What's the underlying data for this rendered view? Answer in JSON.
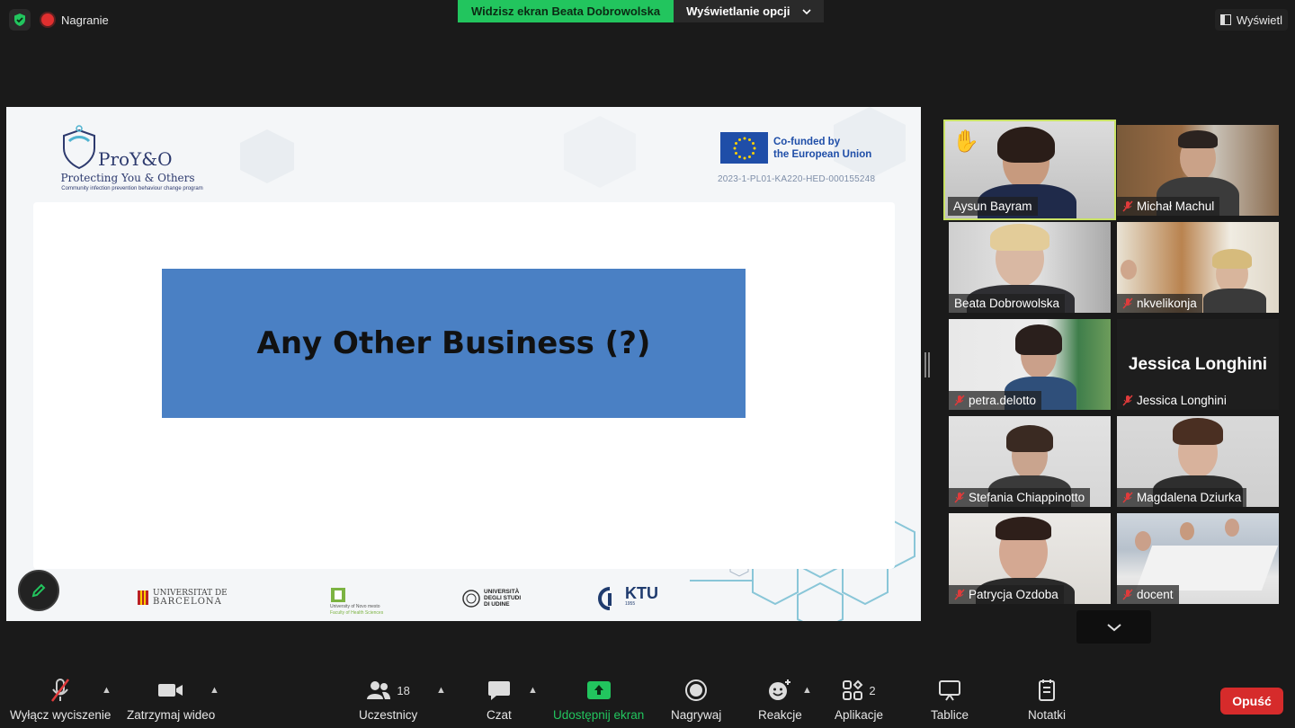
{
  "top_bar": {
    "recording_label": "Nagranie",
    "share_banner": "Widzisz ekran Beata Dobrowolska",
    "view_options_label": "Wyświetlanie opcji",
    "view_button_label": "Wyświetl"
  },
  "slide": {
    "logo_title": "ProY&O",
    "logo_subtitle": "Protecting You & Others",
    "logo_tagline": "Community infection prevention behaviour change program",
    "eu_line1": "Co-funded by",
    "eu_line2": "the European Union",
    "project_code": "2023-1-PL01-KA220-HED-000155248",
    "heading": "Any Other Business (?)",
    "partners": [
      "Universitat de Barcelona",
      "University of Novo mesto Faculty of Health Sciences",
      "Università degli Studi di Udine",
      "KTU"
    ],
    "partner_labels": {
      "barcelona_1": "UNIVERSITAT DE",
      "barcelona_2": "BARCELONA",
      "novo_1": "University of Novo mesto",
      "novo_2": "Faculty of Health Sciences",
      "udine_1": "UNIVERSITÀ",
      "udine_2": "DEGLI STUDI",
      "udine_3": "DI UDINE",
      "ktu": "KTU",
      "ktu_year": "1955"
    }
  },
  "participants": [
    {
      "name": "Aysun Bayram",
      "muted": false,
      "active": true,
      "hand_raised": true
    },
    {
      "name": "Michał Machul",
      "muted": true
    },
    {
      "name": "Beata Dobrowolska",
      "muted": false
    },
    {
      "name": "nkvelikonja",
      "muted": true
    },
    {
      "name": "petra.delotto",
      "muted": true
    },
    {
      "name": "Jessica Longhini",
      "muted": true,
      "video_off": true,
      "display_name": "Jessica Longhini"
    },
    {
      "name": "Stefania Chiappinotto",
      "muted": true
    },
    {
      "name": "Magdalena Dziurka",
      "muted": true
    },
    {
      "name": "Patrycja Ozdoba",
      "muted": true
    },
    {
      "name": "docent",
      "muted": true
    }
  ],
  "toolbar": {
    "unmute": "Wyłącz wyciszenie",
    "stop_video": "Zatrzymaj wideo",
    "participants": "Uczestnicy",
    "participants_count": "18",
    "chat": "Czat",
    "share_screen": "Udostępnij ekran",
    "record": "Nagrywaj",
    "reactions": "Reakcje",
    "apps": "Aplikacje",
    "apps_count": "2",
    "whiteboards": "Tablice",
    "notes": "Notatki",
    "leave": "Opuść"
  },
  "colors": {
    "share_green": "#22c55e",
    "active_speaker": "#c9e265",
    "leave_red": "#d62b2b",
    "slide_blue": "#4a80c4"
  }
}
